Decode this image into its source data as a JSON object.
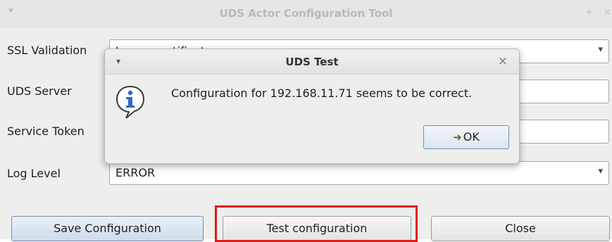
{
  "main_window": {
    "title": "UDS Actor Configuration Tool",
    "menu_glyph": "▾",
    "pin_glyph": "+",
    "close_glyph": "×"
  },
  "form": {
    "ssl_validation": {
      "label": "SSL Validation",
      "value": "Ignore certificate"
    },
    "uds_server": {
      "label": "UDS Server",
      "value": ""
    },
    "service_token": {
      "label": "Service Token",
      "value": ""
    },
    "log_level": {
      "label": "Log Level",
      "value": "ERROR"
    }
  },
  "buttons": {
    "save": "Save Configuration",
    "test": "Test configuration",
    "close": "Close"
  },
  "dialog": {
    "title": "UDS Test",
    "menu_glyph": "▾",
    "close_glyph": "×",
    "message": "Configuration for 192.168.11.71 seems to be correct.",
    "ok_label": "OK",
    "ok_icon_glyph": "➜"
  },
  "icons": {
    "combo_arrow": "▾"
  },
  "colors": {
    "highlight_border": "#e01818",
    "info_icon_blue": "#2a6cc0"
  }
}
